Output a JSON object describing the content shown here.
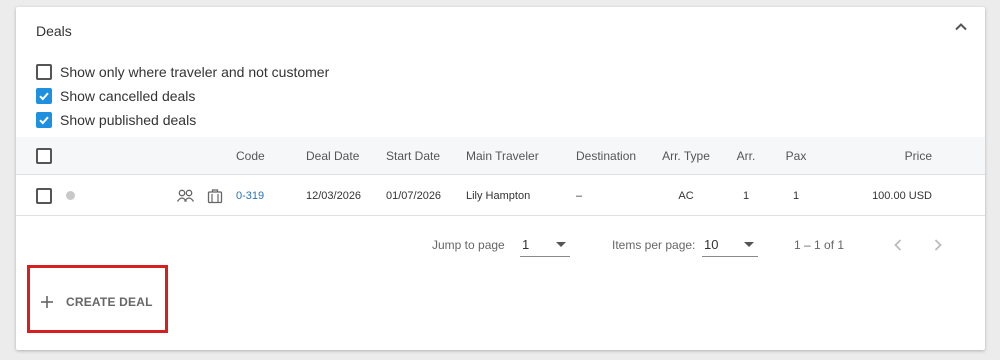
{
  "panel": {
    "title": "Deals"
  },
  "filters": [
    {
      "label": "Show only where traveler and not customer",
      "checked": false
    },
    {
      "label": "Show cancelled deals",
      "checked": true
    },
    {
      "label": "Show published deals",
      "checked": true
    }
  ],
  "table": {
    "headers": {
      "code": "Code",
      "deal_date": "Deal Date",
      "start_date": "Start Date",
      "main_traveler": "Main Traveler",
      "destination": "Destination",
      "arr_type": "Arr. Type",
      "arr": "Arr.",
      "pax": "Pax",
      "price": "Price"
    },
    "rows": [
      {
        "code": "0-319",
        "deal_date": "12/03/2026",
        "start_date": "01/07/2026",
        "main_traveler": "Lily Hampton",
        "destination": "–",
        "arr_type": "AC",
        "arr": "1",
        "pax": "1",
        "price": "100.00 USD"
      }
    ]
  },
  "pagination": {
    "jump_label": "Jump to page",
    "jump_value": "1",
    "items_label": "Items per page:",
    "items_value": "10",
    "range": "1 – 1 of 1"
  },
  "actions": {
    "create_label": "CREATE DEAL"
  },
  "colors": {
    "accent": "#1e90e0",
    "link": "#2a73b7",
    "highlight_border": "#d62020"
  },
  "icons": [
    "chevron-up-icon",
    "people-icon",
    "briefcase-icon",
    "chevron-left-icon",
    "chevron-right-icon",
    "plus-icon"
  ]
}
